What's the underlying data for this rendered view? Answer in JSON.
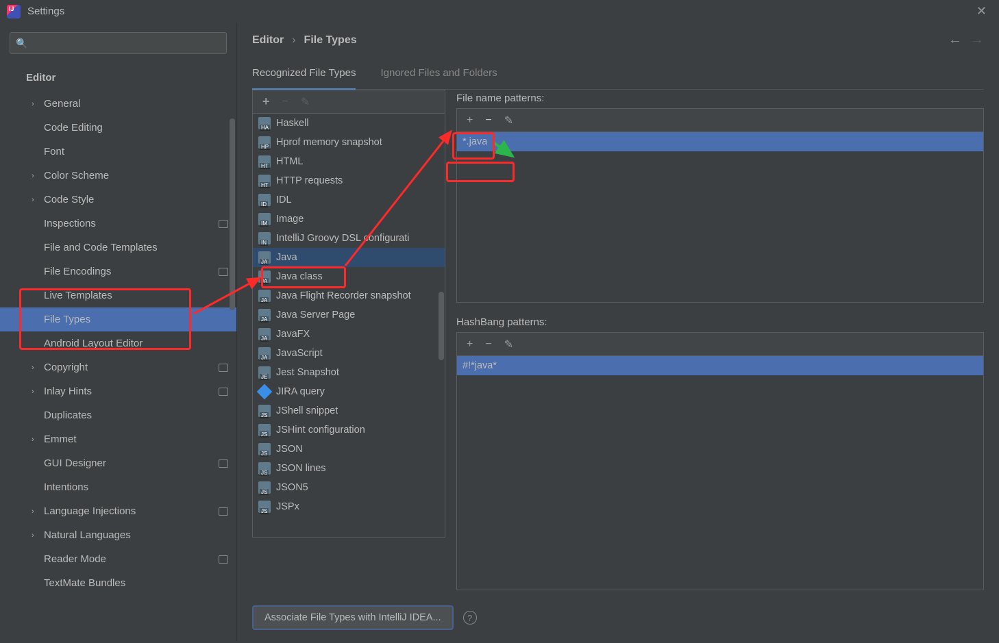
{
  "window": {
    "title": "Settings"
  },
  "breadcrumb": {
    "root": "Editor",
    "leaf": "File Types"
  },
  "tabs": {
    "recognized": "Recognized File Types",
    "ignored": "Ignored Files and Folders"
  },
  "sidebar": {
    "category": "Editor",
    "items": [
      {
        "label": "General",
        "expandable": true
      },
      {
        "label": "Code Editing"
      },
      {
        "label": "Font"
      },
      {
        "label": "Color Scheme",
        "expandable": true
      },
      {
        "label": "Code Style",
        "expandable": true
      },
      {
        "label": "Inspections",
        "badge": true
      },
      {
        "label": "File and Code Templates"
      },
      {
        "label": "File Encodings",
        "badge": true
      },
      {
        "label": "Live Templates"
      },
      {
        "label": "File Types",
        "selected": true
      },
      {
        "label": "Android Layout Editor"
      },
      {
        "label": "Copyright",
        "expandable": true,
        "badge": true
      },
      {
        "label": "Inlay Hints",
        "expandable": true,
        "badge": true
      },
      {
        "label": "Duplicates"
      },
      {
        "label": "Emmet",
        "expandable": true
      },
      {
        "label": "GUI Designer",
        "badge": true
      },
      {
        "label": "Intentions"
      },
      {
        "label": "Language Injections",
        "expandable": true,
        "badge": true
      },
      {
        "label": "Natural Languages",
        "expandable": true
      },
      {
        "label": "Reader Mode",
        "badge": true
      },
      {
        "label": "TextMate Bundles"
      }
    ]
  },
  "filetypes": [
    "Haskell",
    "Hprof memory snapshot",
    "HTML",
    "HTTP requests",
    "IDL",
    "Image",
    "IntelliJ Groovy DSL configurati",
    "Java",
    "Java class",
    "Java Flight Recorder snapshot",
    "Java Server Page",
    "JavaFX",
    "JavaScript",
    "Jest Snapshot",
    "JIRA query",
    "JShell snippet",
    "JSHint configuration",
    "JSON",
    "JSON lines",
    "JSON5",
    "JSPx"
  ],
  "filetypes_selected_index": 7,
  "patterns": {
    "heading": "File name patterns:",
    "items": [
      "*.java"
    ],
    "selected_index": 0
  },
  "hashbang": {
    "heading": "HashBang patterns:",
    "items": [
      "#!*java*"
    ],
    "selected_index": 0
  },
  "associate_button": "Associate File Types with IntelliJ IDEA..."
}
